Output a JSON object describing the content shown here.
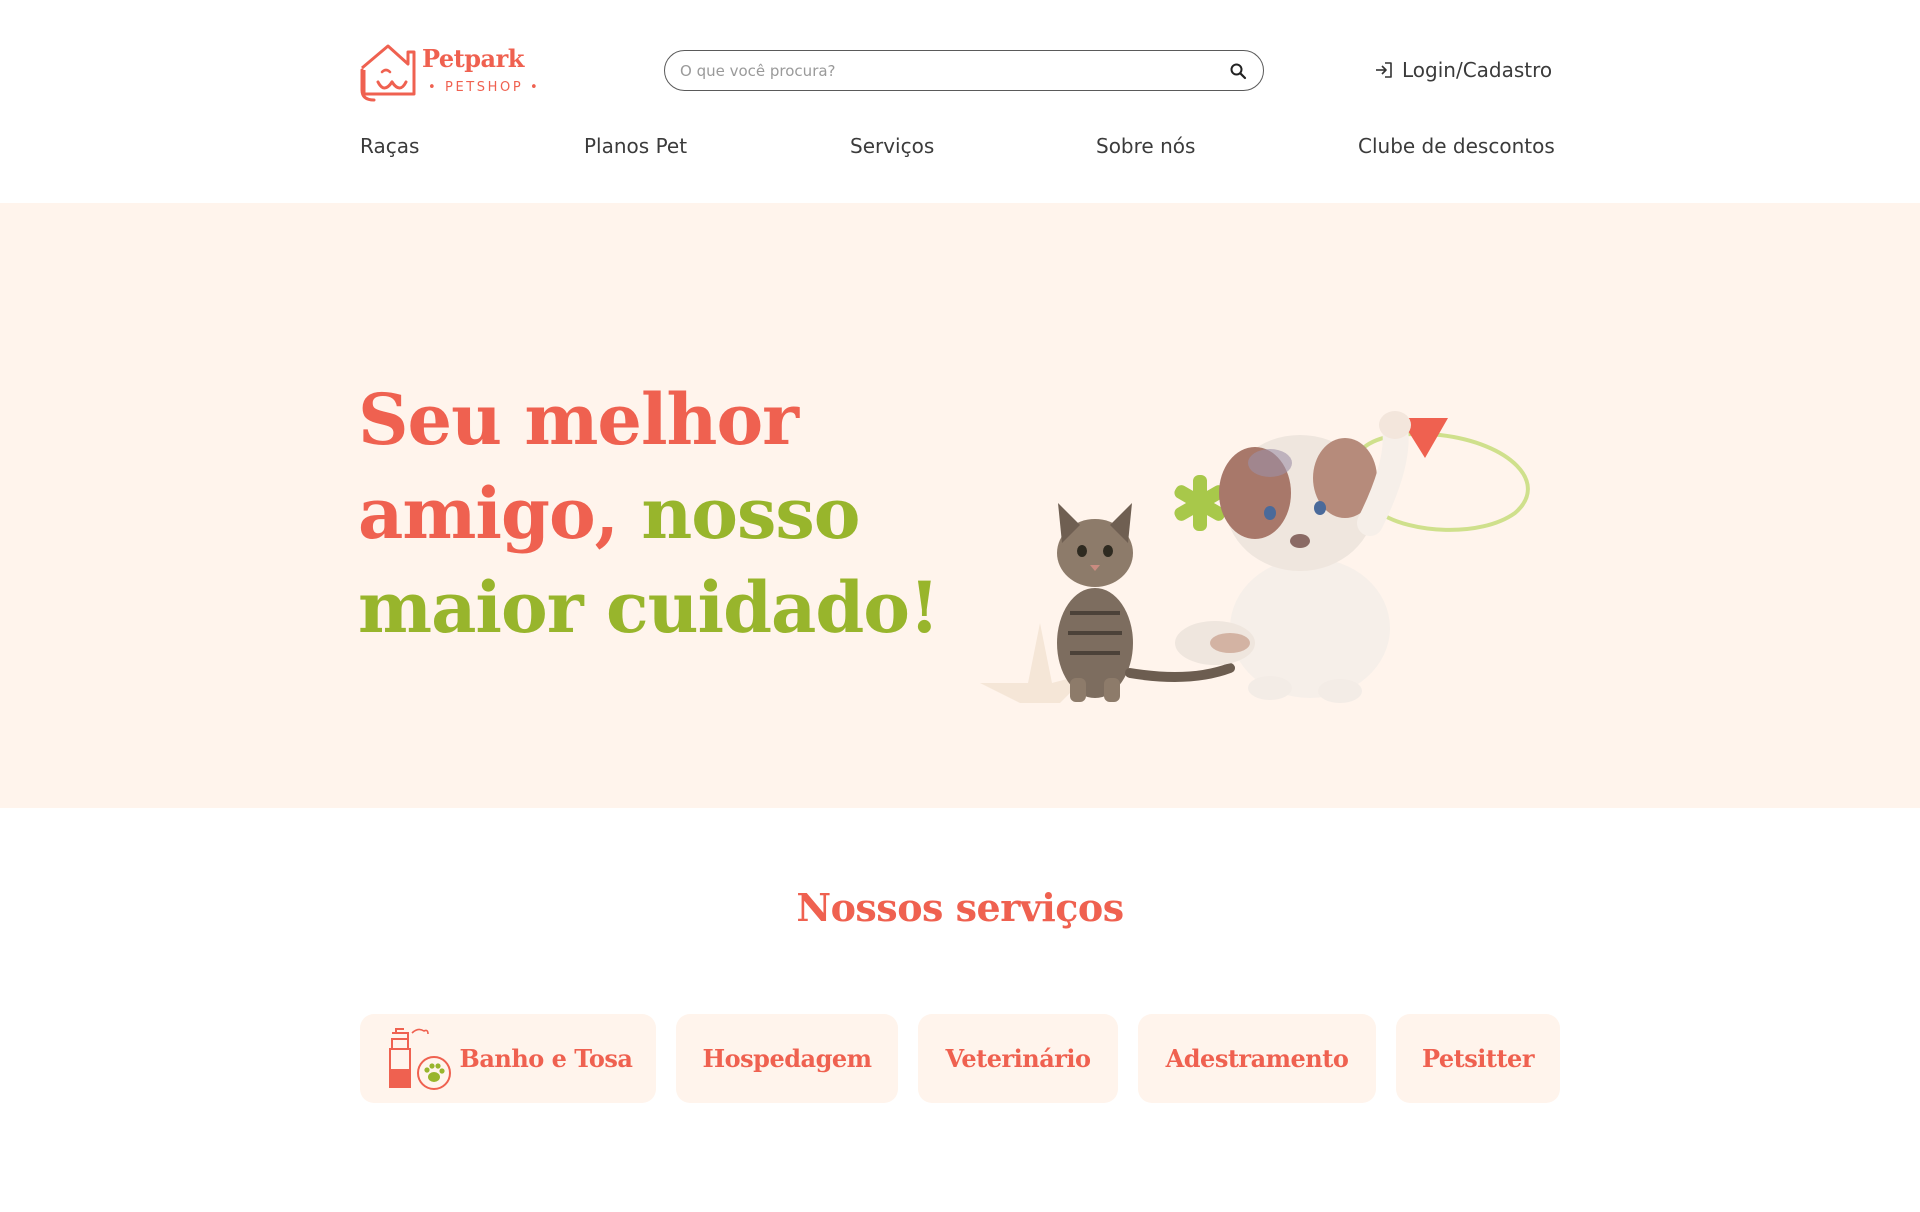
{
  "brand": {
    "name": "Petpark",
    "tagline": "• PETSHOP •",
    "color": "#ef6150"
  },
  "search": {
    "placeholder": "O que você procura?",
    "value": "",
    "icon": "search-icon"
  },
  "login": {
    "label": "Login/Cadastro",
    "icon": "login-icon"
  },
  "nav": {
    "items": [
      {
        "label": "Raças"
      },
      {
        "label": "Planos Pet"
      },
      {
        "label": "Serviços"
      },
      {
        "label": "Sobre nós"
      },
      {
        "label": "Clube de descontos"
      }
    ]
  },
  "hero": {
    "line1": "Seu melhor",
    "line2_coral": "amigo,",
    "line2_green": "nosso",
    "line3": "maior cuidado!",
    "colors": {
      "coral": "#ef6150",
      "green": "#98b52c",
      "background": "#fff4ec"
    }
  },
  "services": {
    "title": "Nossos serviços",
    "items": [
      {
        "label": "Banho e Tosa",
        "icon": "spray-bottle-paw-icon"
      },
      {
        "label": "Hospedagem"
      },
      {
        "label": "Veterinário"
      },
      {
        "label": "Adestramento"
      },
      {
        "label": "Petsitter"
      }
    ]
  }
}
